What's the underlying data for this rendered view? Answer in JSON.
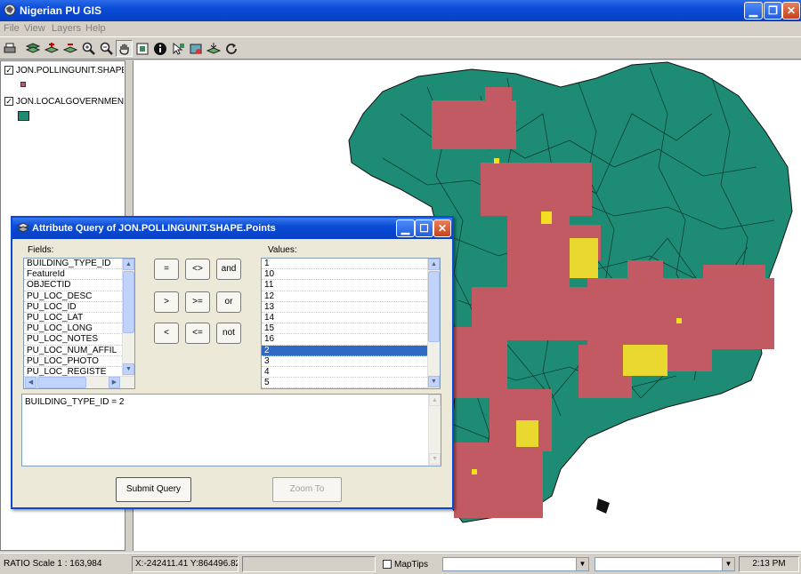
{
  "window": {
    "title": "Nigerian PU GIS"
  },
  "menu": {
    "file": "File",
    "view": "View",
    "layers": "Layers",
    "help": "Help"
  },
  "toolbar": {
    "tools": [
      "print-icon",
      "layers-icon",
      "add-layer-icon",
      "remove-layer-icon",
      "zoom-in-icon",
      "zoom-out-icon",
      "pan-icon",
      "full-extent-icon",
      "identify-icon",
      "select-icon",
      "query-icon",
      "export-icon",
      "refresh-icon"
    ],
    "pressed_tool": "pan-icon"
  },
  "layers": [
    {
      "name": "JON.POLLINGUNIT.SHAPE",
      "checked": true,
      "symbol_color": "#c25a63"
    },
    {
      "name": "JON.LOCALGOVERNMENT",
      "checked": true,
      "symbol_color": "#1e8c74"
    }
  ],
  "map": {
    "land_color": "#1e8c74",
    "point_color": "#c25a63",
    "highlight_color": "#f0e020"
  },
  "dialog": {
    "title": "Attribute Query of JON.POLLINGUNIT.SHAPE.Points",
    "fields_label": "Fields:",
    "values_label": "Values:",
    "fields": [
      "BUILDING_TYPE_ID",
      "FeatureId",
      "OBJECTID",
      "PU_LOC_DESC",
      "PU_LOC_ID",
      "PU_LOC_LAT",
      "PU_LOC_LONG",
      "PU_LOC_NOTES",
      "PU_LOC_NUM_AFFIL",
      "PU_LOC_PHOTO",
      "PU_LOC_REGISTE"
    ],
    "values": [
      "1",
      "10",
      "11",
      "12",
      "13",
      "14",
      "15",
      "16",
      "2",
      "3",
      "4",
      "5"
    ],
    "selected_value": "2",
    "operators": [
      "=",
      "<>",
      "and",
      ">",
      ">=",
      "or",
      "<",
      "<=",
      "not"
    ],
    "query": "BUILDING_TYPE_ID = 2",
    "submit_label": "Submit Query",
    "zoom_label": "Zoom To"
  },
  "status": {
    "scale": "RATIO Scale 1 : 163,984",
    "coords": "X:-242411.41 Y:864496.82",
    "maptips": "MapTips",
    "time": "2:13 PM"
  }
}
